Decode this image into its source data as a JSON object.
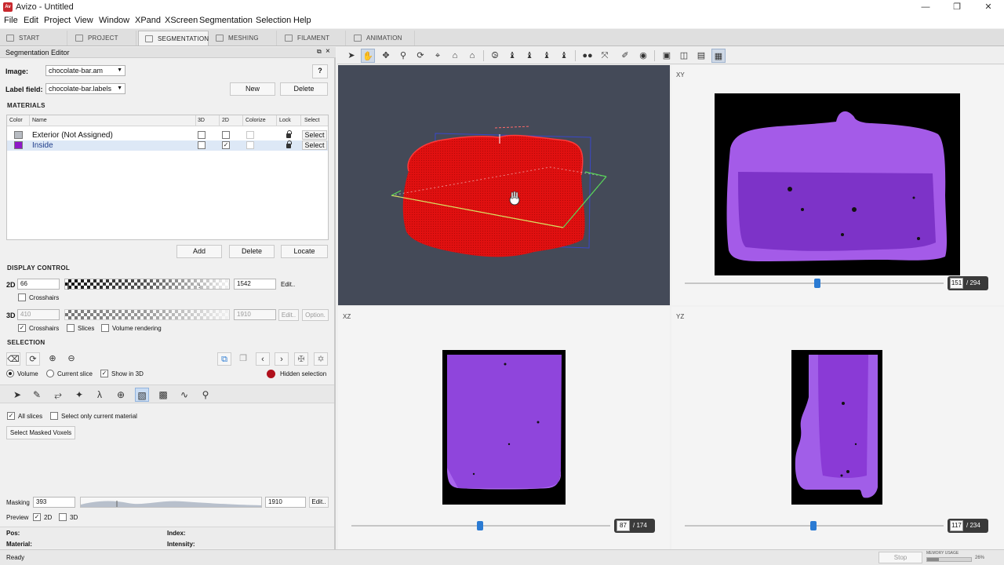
{
  "window": {
    "title": "Avizo - Untitled",
    "app_icon": "Av"
  },
  "menu": [
    "File",
    "Edit",
    "Project",
    "View",
    "Window",
    "XPand",
    "XScreen",
    "Segmentation",
    "Selection",
    "Help"
  ],
  "tabs": [
    {
      "label": "START",
      "icon": "start-icon"
    },
    {
      "label": "PROJECT",
      "icon": "project-icon"
    },
    {
      "label": "SEGMENTATION",
      "icon": "segmentation-icon"
    },
    {
      "label": "MESHING",
      "icon": "meshing-icon"
    },
    {
      "label": "FILAMENT",
      "icon": "filament-icon"
    },
    {
      "label": "ANIMATION",
      "icon": "animation-icon"
    }
  ],
  "editor": {
    "title": "Segmentation Editor",
    "image_label": "Image:",
    "image_value": "chocolate-bar.am",
    "help": "?",
    "labelfield_label": "Label field:",
    "labelfield_value": "chocolate-bar.labels",
    "new_btn": "New",
    "delete_btn": "Delete",
    "materials_title": "MATERIALS",
    "columns": [
      "Color",
      "Name",
      "3D",
      "2D",
      "Colorize",
      "Lock",
      "Select"
    ],
    "materials": [
      {
        "name": "Exterior (Not Assigned)",
        "color": "#b8bcc2",
        "d3": false,
        "d2": false,
        "select": "Select"
      },
      {
        "name": "Inside",
        "color": "#8e18c8",
        "d3": false,
        "d2": true,
        "select": "Select"
      }
    ],
    "add_btn": "Add",
    "delete_btn2": "Delete",
    "locate_btn": "Locate",
    "display_title": "DISPLAY CONTROL",
    "d2_label": "2D",
    "d2_min": "66",
    "d2_max": "1542",
    "edit": "Edit..",
    "crosshairs": "Crosshairs",
    "d3_label": "3D",
    "d3_min": "410",
    "d3_max": "1910",
    "option": "Option.",
    "slices": "Slices",
    "volume_rendering": "Volume rendering",
    "selection_title": "SELECTION",
    "volume": "Volume",
    "current_slice": "Current slice",
    "show_in_3d": "Show in 3D",
    "hidden_selection": "Hidden selection",
    "all_slices": "All slices",
    "select_only_current": "Select only current material",
    "select_masked": "Select Masked Voxels",
    "masking": "Masking",
    "mask_min": "393",
    "mask_max": "1910",
    "preview": "Preview",
    "preview_2d": "2D",
    "preview_3d": "3D",
    "pos": "Pos:",
    "index": "Index:",
    "material": "Material:",
    "intensity": "Intensity:"
  },
  "viewers": {
    "xy": {
      "label": "XY",
      "current": "151",
      "total": "/ 294",
      "position": 0.51
    },
    "xz": {
      "label": "XZ",
      "current": "87",
      "total": "/ 174",
      "position": 0.5
    },
    "yz": {
      "label": "YZ",
      "current": "117",
      "total": "/ 234",
      "position": 0.5
    }
  },
  "status": {
    "text": "Ready",
    "stop": "Stop",
    "memory_label": "MEMORY USAGE",
    "memory_pct": "26%"
  },
  "colors": {
    "accent": "#2b7bd3",
    "material_red": "#e01010",
    "material_purple": "#8e3ad6",
    "viewport_bg": "#444a58",
    "hidden_selection": "#b0101c"
  }
}
